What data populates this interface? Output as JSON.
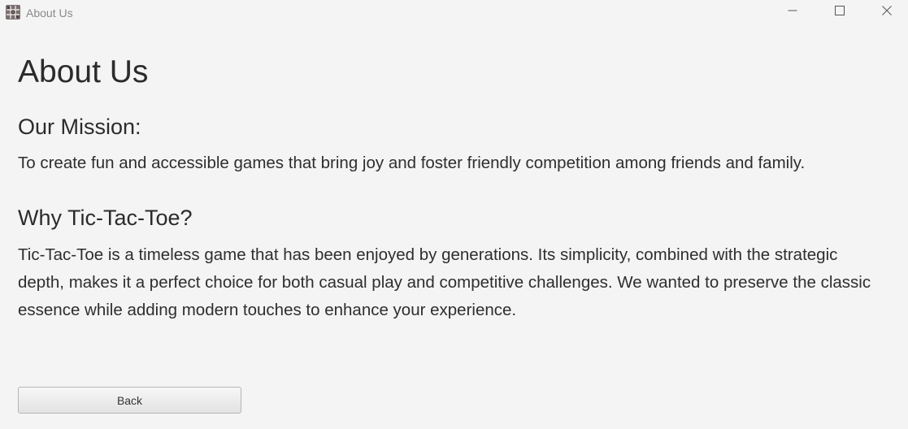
{
  "window": {
    "title": "About Us",
    "app_icon": "tic-tac-toe-app-icon",
    "controls": {
      "minimize_icon": "minimize-icon",
      "maximize_icon": "maximize-icon",
      "close_icon": "close-icon"
    }
  },
  "page": {
    "title": "About Us",
    "sections": [
      {
        "heading": "Our Mission:",
        "text": "To create fun and accessible games that bring joy and foster friendly competition among friends and family."
      },
      {
        "heading": "Why Tic-Tac-Toe?",
        "text": "Tic-Tac-Toe is a timeless game that has been enjoyed by generations. Its simplicity, combined with the strategic depth, makes it a perfect choice for both casual play and competitive challenges. We wanted to preserve the classic essence while adding modern touches to enhance your experience."
      }
    ]
  },
  "actions": {
    "back_label": "Back"
  }
}
